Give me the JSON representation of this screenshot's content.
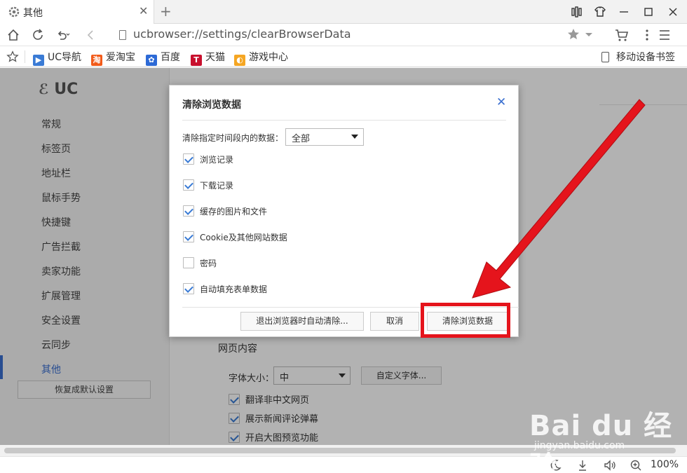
{
  "tab": {
    "title": "其他",
    "close": "✕",
    "new": "+"
  },
  "window": {
    "restore_label": "▯▯",
    "skin_label": "👕",
    "min": "—",
    "max": "☐",
    "close": "✕"
  },
  "address": {
    "url": "ucbrowser://settings/clearBrowserData"
  },
  "bookmarks": {
    "items": [
      {
        "label": "UC导航",
        "color": "#3a7bd5"
      },
      {
        "label": "爱淘宝",
        "color": "#f25b1a"
      },
      {
        "label": "百度",
        "color": "#2d6ad6"
      },
      {
        "label": "天猫",
        "color": "#c8102e"
      },
      {
        "label": "游戏中心",
        "color": "#f5a623"
      }
    ],
    "mobile": "移动设备书签"
  },
  "sidebar": {
    "logo": "UC",
    "items": [
      "常规",
      "标签页",
      "地址栏",
      "鼠标手势",
      "快捷键",
      "广告拦截",
      "卖家功能",
      "扩展管理",
      "安全设置",
      "云同步",
      "其他"
    ],
    "restore": "恢复成默认设置"
  },
  "content": {
    "section_title": "网页内容",
    "font_label": "字体大小：",
    "font_value": "中",
    "custom_font": "自定义字体...",
    "checks": [
      {
        "label": "翻译非中文网页",
        "checked": true
      },
      {
        "label": "展示新闻评论弹幕",
        "checked": true
      },
      {
        "label": "开启大图预览功能",
        "checked": true
      }
    ]
  },
  "dialog": {
    "title": "清除浏览数据",
    "close": "✕",
    "range_label": "清除指定时间段内的数据：",
    "range_value": "全部",
    "items": [
      {
        "label": "浏览记录",
        "checked": true
      },
      {
        "label": "下载记录",
        "checked": true
      },
      {
        "label": "缓存的图片和文件",
        "checked": true
      },
      {
        "label": "Cookie及其他网站数据",
        "checked": true
      },
      {
        "label": "密码",
        "checked": false
      },
      {
        "label": "自动填充表单数据",
        "checked": true
      }
    ],
    "auto_clear_button": "退出浏览器时自动清除...",
    "cancel_button": "取消",
    "clear_button": "清除浏览数据"
  },
  "status": {
    "zoom": "100%"
  },
  "watermark": {
    "brand": "Bai du 经验",
    "url": "jingyan.baidu.com"
  },
  "colors": {
    "accent": "#3a6fd0",
    "highlight": "#e5141c"
  }
}
